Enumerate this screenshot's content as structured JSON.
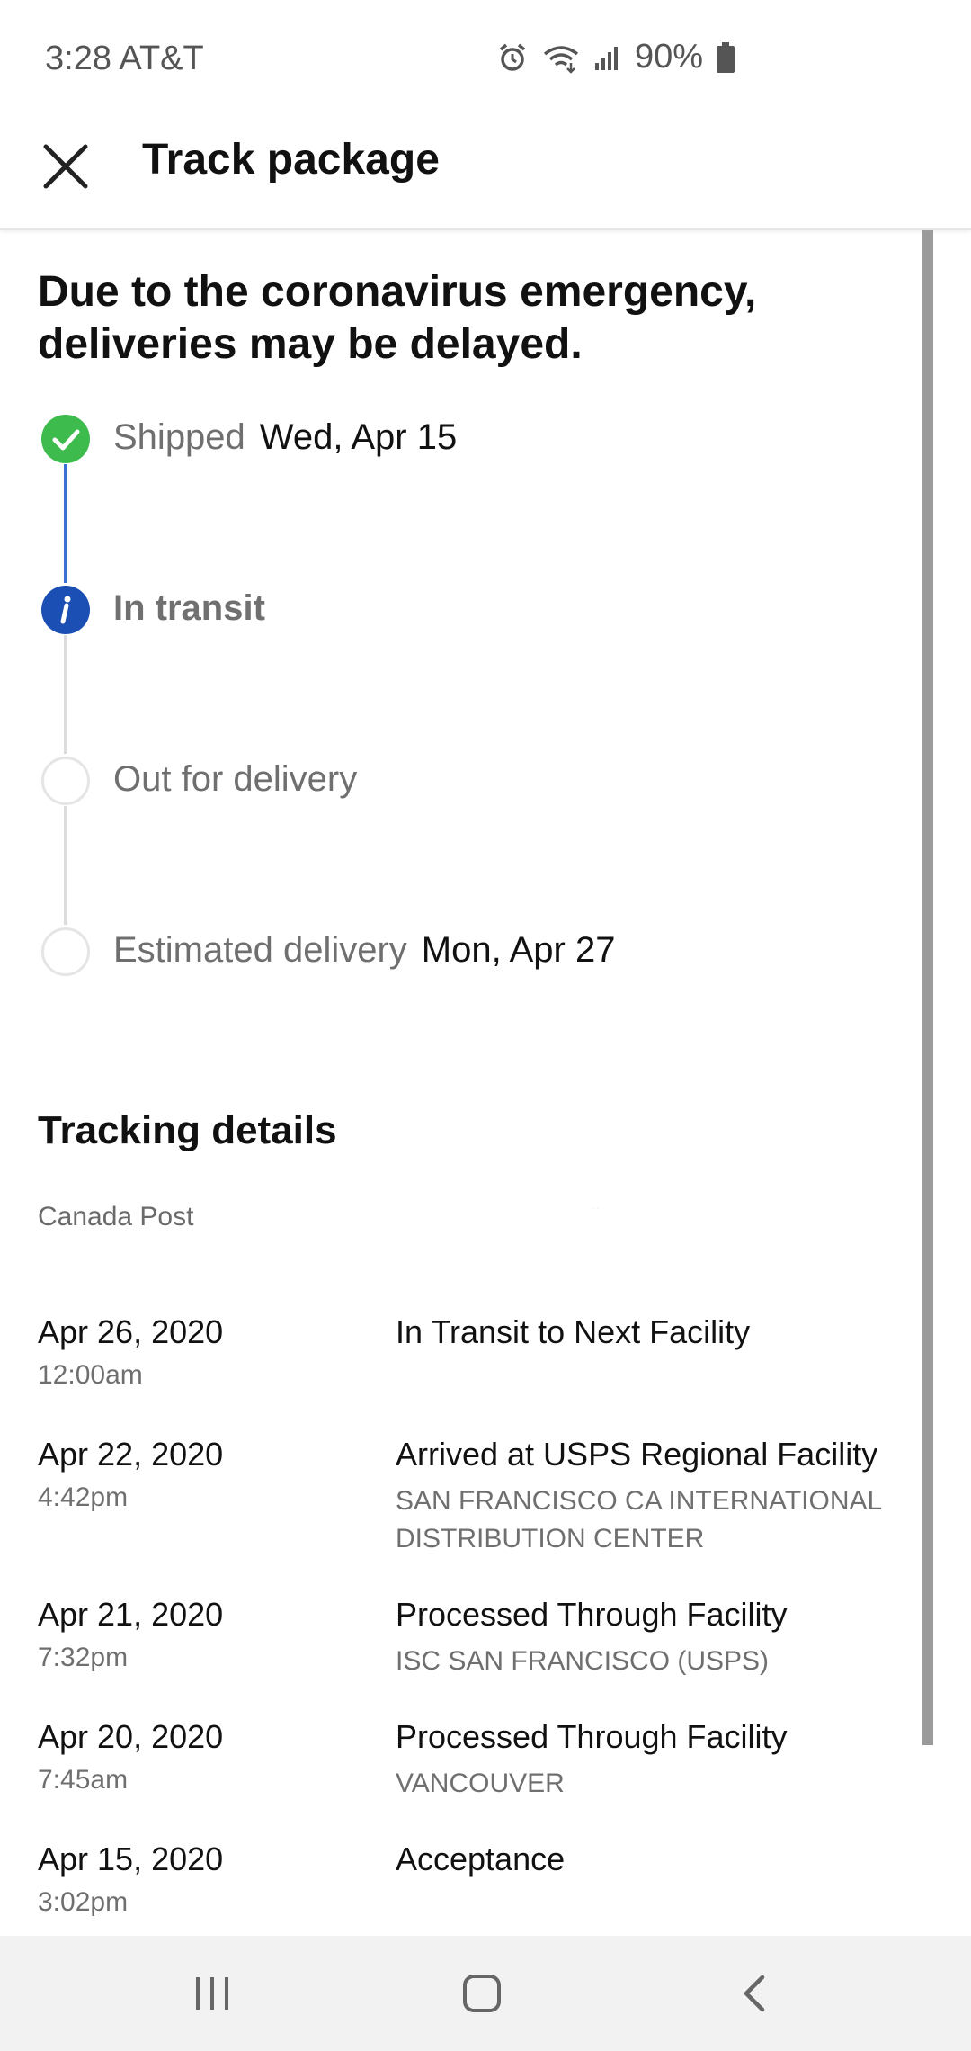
{
  "status_bar": {
    "time_carrier": "3:28 AT&T",
    "battery": "90%",
    "icons": [
      "alarm-icon",
      "wifi-icon",
      "signal-icon",
      "battery-icon"
    ]
  },
  "app_bar": {
    "close_icon": "close-icon",
    "title": "Track package"
  },
  "notice": "Due to the coronavirus emergency, deliveries may be delayed.",
  "timeline": {
    "steps": [
      {
        "label": "Shipped",
        "date": "Wed, Apr 15",
        "state": "done",
        "color": "#3dbb4d"
      },
      {
        "label": "In transit",
        "date": "",
        "state": "current",
        "color": "#1b4fb3"
      },
      {
        "label": "Out for delivery",
        "date": "",
        "state": "pending",
        "color": "#e5e5e5"
      },
      {
        "label": "Estimated delivery",
        "date": "Mon, Apr 27",
        "state": "pending",
        "color": "#e5e5e5"
      }
    ],
    "active_line_color": "#3b6fd4",
    "inactive_line_color": "#dcdcdc"
  },
  "tracking": {
    "title": "Tracking details",
    "carrier": "Canada Post",
    "tracking_number": ". .",
    "events": [
      {
        "date": "Apr 26, 2020",
        "time": "12:00am",
        "status": "In Transit to Next Facility",
        "location": ""
      },
      {
        "date": "Apr 22, 2020",
        "time": "4:42pm",
        "status": "Arrived at USPS Regional Facility",
        "location": "SAN FRANCISCO CA INTERNATIONAL DISTRIBUTION CENTER"
      },
      {
        "date": "Apr 21, 2020",
        "time": "7:32pm",
        "status": "Processed Through Facility",
        "location": "ISC SAN FRANCISCO (USPS)"
      },
      {
        "date": "Apr 20, 2020",
        "time": "7:45am",
        "status": "Processed Through Facility",
        "location": "VANCOUVER"
      },
      {
        "date": "Apr 15, 2020",
        "time": "3:02pm",
        "status": "Acceptance",
        "location": ""
      }
    ]
  },
  "nav_bar": {
    "buttons": [
      "recent-apps-icon",
      "home-icon",
      "back-icon"
    ]
  }
}
